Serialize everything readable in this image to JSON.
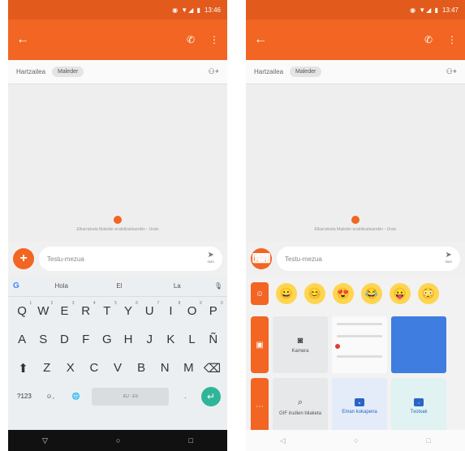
{
  "left": {
    "status_time": "13:46",
    "status_icons": "◉ ▼◢ ▮",
    "recipient_label": "Hartzailea",
    "recipient_chip": "Maleder",
    "hint": "Elkarrizketa Maleder erabiltzailearekin - Unán",
    "composer_placeholder": "Testu-mezua",
    "send_sub": "SMS",
    "suggestions": [
      "Hola",
      "El",
      "La"
    ],
    "keys_row1": [
      "Q",
      "W",
      "E",
      "R",
      "T",
      "Y",
      "U",
      "I",
      "O",
      "P"
    ],
    "keys_row1_sup": [
      "1",
      "2",
      "3",
      "4",
      "5",
      "6",
      "7",
      "8",
      "9",
      "0"
    ],
    "keys_row2": [
      "A",
      "S",
      "D",
      "F",
      "G",
      "H",
      "J",
      "K",
      "L",
      "Ñ"
    ],
    "keys_row3": [
      "Z",
      "X",
      "C",
      "V",
      "B",
      "N",
      "M"
    ],
    "sym_key": "?123",
    "space_label": "EU · ES"
  },
  "right": {
    "status_time": "13:47",
    "status_icons": "◉ ▼◢ ▮",
    "recipient_label": "Hartzailea",
    "recipient_chip": "Maleder",
    "hint": "Elkarrizketa Maleder erabiltzailearekin - Unán",
    "composer_placeholder": "Testu-mezua",
    "send_sub": "SMS",
    "emojis": [
      "😀",
      "😊",
      "😍",
      "😂",
      "😛",
      "😳"
    ],
    "tiles": {
      "camera": "Kamera",
      "gif": "GIF irudien bilaketa",
      "location": "Eman kokapena",
      "audio": "Txotxak"
    }
  }
}
